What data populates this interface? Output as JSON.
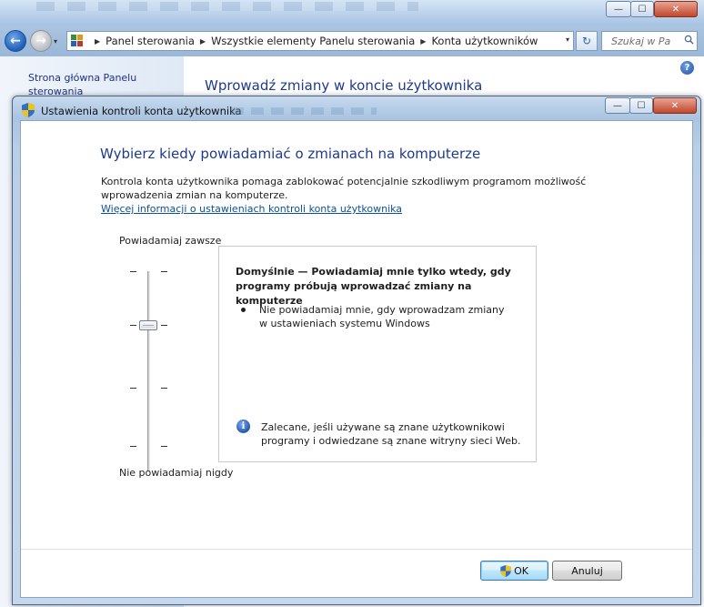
{
  "background_window": {
    "caption": {
      "minimize": "—",
      "maximize": "☐",
      "close": "✕"
    },
    "nav": {
      "back": "←",
      "forward": "→",
      "dropdown": "▾"
    },
    "breadcrumb": [
      "Panel sterowania",
      "Wszystkie elementy Panelu sterowania",
      "Konta użytkowników"
    ],
    "breadcrumb_sep": "▶",
    "address_dropdown": "▾",
    "refresh": "↻",
    "search_placeholder": "Szukaj w Pa",
    "sidebar_link": "Strona główna Panelu sterowania",
    "heading": "Wprowadź zmiany w koncie użytkownika",
    "help": "?"
  },
  "dialog": {
    "title": "Ustawienia kontroli konta użytkownika",
    "caption": {
      "minimize": "—",
      "maximize": "☐",
      "close": "✕"
    },
    "heading": "Wybierz kiedy powiadamiać o zmianach na komputerze",
    "description": "Kontrola konta użytkownika pomaga zablokować potencjalnie szkodliwym programom możliwość wprowadzenia zmian na komputerze.",
    "link": "Więcej informacji o ustawieniach kontroli konta użytkownika",
    "slider": {
      "top_label": "Powiadamiaj zawsze",
      "bottom_label": "Nie powiadamiaj nigdy",
      "levels": 4,
      "selected_level": 2
    },
    "info": {
      "title": "Domyślnie — Powiadamiaj mnie tylko wtedy, gdy programy próbują wprowadzać zmiany na komputerze",
      "bullet": "Nie powiadamiaj mnie, gdy wprowadzam zmiany w ustawieniach systemu Windows",
      "icon": "i",
      "note": "Zalecane, jeśli używane są znane użytkownikowi programy i odwiedzane są znane witryny sieci Web."
    },
    "buttons": {
      "ok": "OK",
      "cancel": "Anuluj"
    }
  },
  "colors": {
    "heading": "#1e3a8c",
    "link": "#0b50a0",
    "accent": "#3c7fb1"
  }
}
